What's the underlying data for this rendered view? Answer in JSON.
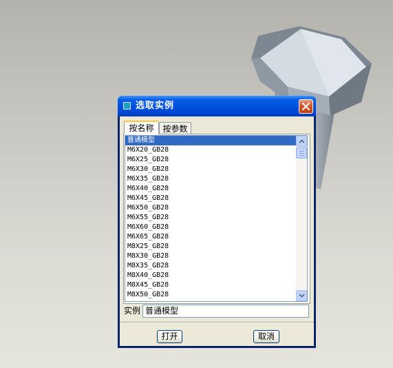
{
  "dialog": {
    "title": "选取实例",
    "tabs": [
      {
        "label": "按名称",
        "active": true
      },
      {
        "label": "按参数",
        "active": false
      }
    ],
    "list": {
      "items": [
        "普通模型",
        "M6X20_GB28",
        "M6X25_GB28",
        "M6X30_GB28",
        "M6X35_GB28",
        "M6X40_GB28",
        "M6X45_GB28",
        "M6X50_GB28",
        "M6X55_GB28",
        "M6X60_GB28",
        "M6X65_GB28",
        "M8X25_GB28",
        "M8X30_GB28",
        "M8X35_GB28",
        "M8X40_GB28",
        "M8X45_GB28",
        "M8X50_GB28"
      ],
      "selected_index": 0
    },
    "instance": {
      "label": "实例",
      "value": "普通模型"
    },
    "buttons": {
      "open": "打开",
      "cancel": "取消"
    }
  },
  "colors": {
    "titlebar": "#0053e0",
    "selection": "#316ac5",
    "dialog_face": "#ece9d8"
  }
}
